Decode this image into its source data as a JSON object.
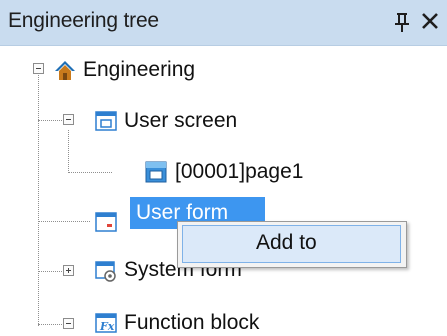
{
  "panel": {
    "title": "Engineering tree",
    "pin_icon": "pin-icon",
    "close_icon": "close-icon"
  },
  "tree": {
    "root": {
      "label": "Engineering",
      "icon": "home-icon",
      "expanded": true
    },
    "items": [
      {
        "label": "User screen",
        "icon": "window-icon",
        "expanded": true
      },
      {
        "label": "[00001]page1",
        "icon": "page-icon"
      },
      {
        "label": "User form",
        "icon": "form-icon",
        "selected": true
      },
      {
        "label": "System form",
        "icon": "system-form-icon",
        "expanded": false
      },
      {
        "label": "Function block",
        "icon": "function-block-icon",
        "expanded": true
      }
    ]
  },
  "context_menu": {
    "items": [
      {
        "label": "Add to"
      }
    ]
  },
  "colors": {
    "titlebar": "#c9dcef",
    "selection": "#3d96f0",
    "menu_highlight": "#dbe9f9"
  }
}
